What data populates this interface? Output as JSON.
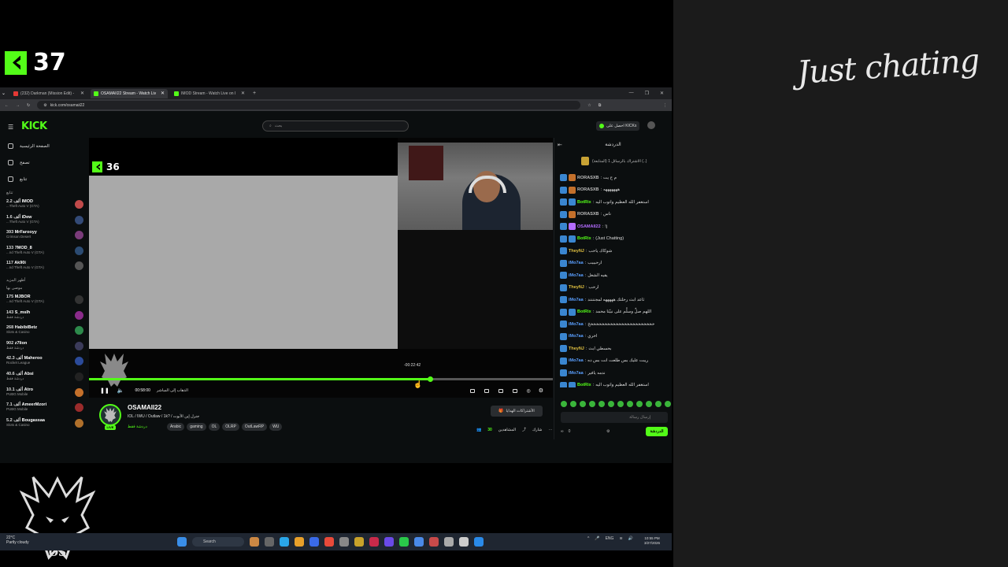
{
  "overlay": {
    "viewer_count": "37",
    "category_logo": "Just chating"
  },
  "browser": {
    "tabs": [
      {
        "title": "(232) Darkman (Mission Edit) -",
        "active": false,
        "icon_color": "#e53935"
      },
      {
        "title": "OSAMAII22 Stream - Watch Liv",
        "active": true,
        "icon_color": "#53fc18"
      },
      {
        "title": "IMOD Stream - Watch Live on I",
        "active": false,
        "icon_color": "#53fc18"
      }
    ],
    "url": "kick.com/osamaii22"
  },
  "site": {
    "logo": "KICK",
    "search_placeholder": "بحث",
    "get_kicks": "احصل على KICKs",
    "nav": [
      "الصفحة الرئيسية",
      "تصفح",
      "تتابع"
    ],
    "following_label": "تتابع",
    "following": [
      {
        "name": "IMOD",
        "viewers": "2.2 ألف",
        "game": "...Theft Auto V (GTA)",
        "color": "#c04a4a"
      },
      {
        "name": "iDew",
        "viewers": "1.6 ألف",
        "game": "...Theft Auto V (GTA)",
        "color": "#334a77"
      },
      {
        "name": "MrFarooyy",
        "viewers": "393",
        "game": "Crimson Desert",
        "color": "#7a3b7a"
      },
      {
        "name": "7MOD_8",
        "viewers": "133",
        "game": "...nd Theft Auto V (GTA)",
        "color": "#2b4b72"
      },
      {
        "name": "Ak90i",
        "viewers": "117",
        "game": "...nd Theft Auto V (GTA)",
        "color": "#555555"
      }
    ],
    "show_more": "أظهر المزيد",
    "recommended_label": "موصى بها",
    "recommended": [
      {
        "name": "MJBOR",
        "viewers": "175",
        "game": "...nd Theft Auto V (GTA)",
        "color": "#333333"
      },
      {
        "name": "S_mslh",
        "viewers": "143",
        "game": "دردشة فقط",
        "color": "#8a2b8a"
      },
      {
        "name": "HabibiBetz",
        "viewers": "268",
        "game": "Slots & Casino",
        "color": "#2d8a4b"
      },
      {
        "name": "z7lion",
        "viewers": "902",
        "game": "دردشة فقط",
        "color": "#3b3b5a"
      },
      {
        "name": "Maheroo",
        "viewers": "42.3 ألف",
        "game": "Rocket League",
        "color": "#2b4b9a"
      },
      {
        "name": "Absi",
        "viewers": "40.6 ألف",
        "game": "دردشة فقط",
        "color": "#222222"
      },
      {
        "name": "Atro",
        "viewers": "10.1 ألف",
        "game": "PUBG Mobile",
        "color": "#c4702b"
      },
      {
        "name": "AmeerMzori",
        "viewers": "7.1 ألف",
        "game": "PUBG Mobile",
        "color": "#9a2b2b"
      },
      {
        "name": "Bougassaa",
        "viewers": "5.2 ألف",
        "game": "Slots & Casino",
        "color": "#b0702b"
      }
    ]
  },
  "player": {
    "inner_viewer_count": "36",
    "timestamp": "-00:22:42",
    "elapsed": "00:58:00",
    "go_live": "الذهاب إلى المباشر",
    "progress_fraction": 0.735
  },
  "stream": {
    "streamer": "OSAMAII22",
    "title": "IOL / IWU / Outlaw / 1k? / جنرل إبن الأبوت",
    "category": "دردشة فقط",
    "tags": [
      "Arabic",
      "gaming",
      "OL",
      "OLRP",
      "OutLawRP",
      "WU"
    ],
    "follow_label": "الأشتراكات الهدايا",
    "viewers": "30",
    "viewers_label": "المشاهدين",
    "share": "شارك"
  },
  "chat": {
    "title": "الدردشة",
    "pinned": "(المتابعة) الاشتراك بالرسائل 1 (..)",
    "messages": [
      {
        "user": "RORASXB",
        "text": "م ح يت",
        "color": "#bbbbbb",
        "badge": "#c4702b"
      },
      {
        "user": "RORASXB",
        "text": "هههههههه",
        "color": "#bbbbbb",
        "badge": "#c4702b"
      },
      {
        "user": "BotRix",
        "text": "استغفر الله العظيم واتوب اليه",
        "color": "#53fc18",
        "badge": "#3a86d0"
      },
      {
        "user": "RORASXB",
        "text": "ناس",
        "color": "#bbbbbb",
        "badge": "#c4702b"
      },
      {
        "user": "OSAMAII22",
        "text": "!j",
        "color": "#b46cff",
        "badge": "#b46cff"
      },
      {
        "user": "BotRix",
        "text": "(Just Chatting)",
        "color": "#53fc18",
        "badge": "#3a86d0"
      },
      {
        "user": "TheyNJ",
        "text": "شوكاك ياحب",
        "color": "#e0c040",
        "badge": ""
      },
      {
        "user": "iMo7aa",
        "text": "ارحبببب",
        "color": "#5a9fff",
        "badge": ""
      },
      {
        "user": "iMo7aa",
        "text": "يقيه الشغل",
        "color": "#5a9fff",
        "badge": ""
      },
      {
        "user": "TheyNJ",
        "text": "ارحب",
        "color": "#e0c040",
        "badge": ""
      },
      {
        "user": "iMo7aa",
        "text": "ثاعد ابث رحلتك هههههه لمجنننند",
        "color": "#5a9fff",
        "badge": ""
      },
      {
        "user": "BotRix",
        "text": "اللهم صلِّ وسلِّم على نبيّنا محمد",
        "color": "#53fc18",
        "badge": "#3a86d0"
      },
      {
        "user": "iMo7aa",
        "text": "خخخخخخخخخخخخخخخخخخخخخخخخ",
        "color": "#5a9fff",
        "badge": ""
      },
      {
        "user": "iMo7aa",
        "text": "اخري",
        "color": "#5a9fff",
        "badge": ""
      },
      {
        "user": "TheyNJ",
        "text": "بحسطي ابث",
        "color": "#e0c040",
        "badge": ""
      },
      {
        "user": "iMo7aa",
        "text": "ريبت عليك بس طلعت انت بس ده",
        "color": "#5a9fff",
        "badge": ""
      },
      {
        "user": "iMo7aa",
        "text": "ندمه يافير",
        "color": "#5a9fff",
        "badge": ""
      },
      {
        "user": "BotRix",
        "text": "استغفر الله العظيم واتوب اليه",
        "color": "#53fc18",
        "badge": "#3a86d0"
      }
    ],
    "input_placeholder": "إرسال رسالة",
    "kicks_count": "0",
    "send_label": "الدردشة"
  },
  "taskbar": {
    "temperature": "22°C",
    "weather": "Partly cloudy",
    "search": "Search",
    "lang": "ENG",
    "time": "10:55 PM",
    "date": "3/27/2026"
  }
}
